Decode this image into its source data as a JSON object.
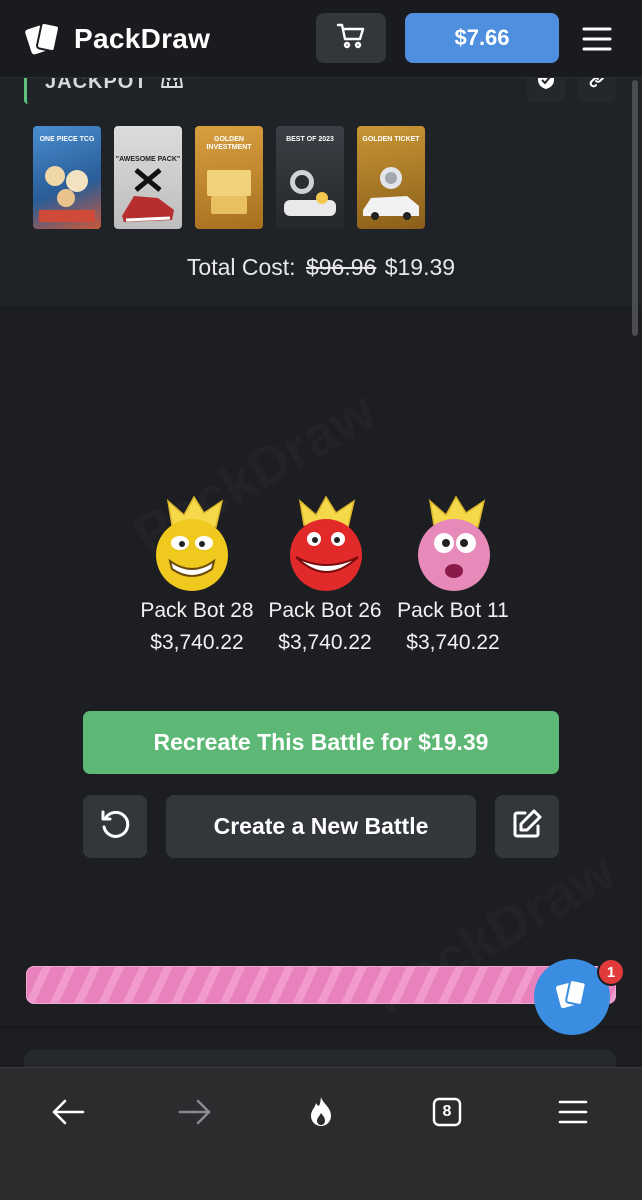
{
  "header": {
    "brand": "PackDraw",
    "balance": "$7.66",
    "icons": [
      "packdraw-logo-icon",
      "cart-icon",
      "hamburger-menu-icon"
    ]
  },
  "jackpot": {
    "label": "JACKPOT",
    "icons": [
      "crown-outline-icon",
      "shield-check-icon",
      "link-icon"
    ]
  },
  "packs": [
    {
      "label": "ONE PIECE TCG",
      "color": "#3a78b8"
    },
    {
      "label": "\"AWESOME PACK\"",
      "color": "#c9c9c9"
    },
    {
      "label": "GOLDEN INVESTMENT",
      "color": "#c98a2a"
    },
    {
      "label": "BEST OF 2023",
      "color": "#3b3e44"
    },
    {
      "label": "GOLDEN TICKET",
      "color": "#b8862b"
    }
  ],
  "total": {
    "label": "Total Cost:",
    "original": "$96.96",
    "price": "$19.39"
  },
  "bots": [
    {
      "name": "Pack Bot 28",
      "value": "$3,740.22",
      "avatar": "yellow-grin-bot-avatar"
    },
    {
      "name": "Pack Bot 26",
      "value": "$3,740.22",
      "avatar": "red-grin-bot-avatar"
    },
    {
      "name": "Pack Bot 11",
      "value": "$3,740.22",
      "avatar": "pink-bot-avatar"
    }
  ],
  "actions": {
    "recreate": "Recreate This Battle for $19.39",
    "new_battle": "Create a New Battle",
    "icons": [
      "refresh-icon",
      "edit-icon"
    ]
  },
  "progress": {
    "fraction": 1.0,
    "color": "#e981bd"
  },
  "chat": {
    "badge": "1"
  },
  "browser": {
    "tabs_count": "8",
    "icons": [
      "back-arrow-icon",
      "forward-arrow-icon",
      "flame-icon",
      "tabs-icon",
      "browser-menu-icon"
    ]
  },
  "colors": {
    "accent_blue": "#4f8fe0",
    "accent_green": "#5cb874",
    "background": "#1c1e21"
  }
}
